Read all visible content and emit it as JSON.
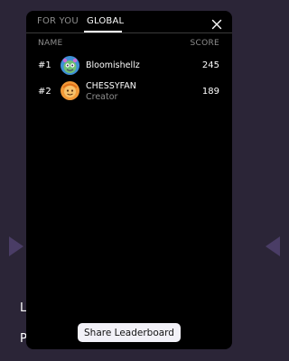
{
  "background": {
    "text_line_1": "L",
    "text_line_2": "P"
  },
  "tabs": {
    "for_you": "FOR YOU",
    "global": "GLOBAL",
    "active": "global"
  },
  "columns": {
    "name": "NAME",
    "score": "SCORE"
  },
  "leaderboard": [
    {
      "rank": "#1",
      "name": "Bloomishellz",
      "subtitle": "",
      "score": "245",
      "avatar_color": "#6fbf73"
    },
    {
      "rank": "#2",
      "name": "CHESSYFAN",
      "subtitle": "Creator",
      "score": "189",
      "avatar_color": "#f29a38"
    }
  ],
  "share_button": "Share Leaderboard",
  "colors": {
    "page_background": "#2b2537",
    "modal_background": "#000000",
    "muted_text": "#8e8e8e",
    "button_background": "#f2f1f8"
  },
  "icons": {
    "close": "close-icon"
  }
}
